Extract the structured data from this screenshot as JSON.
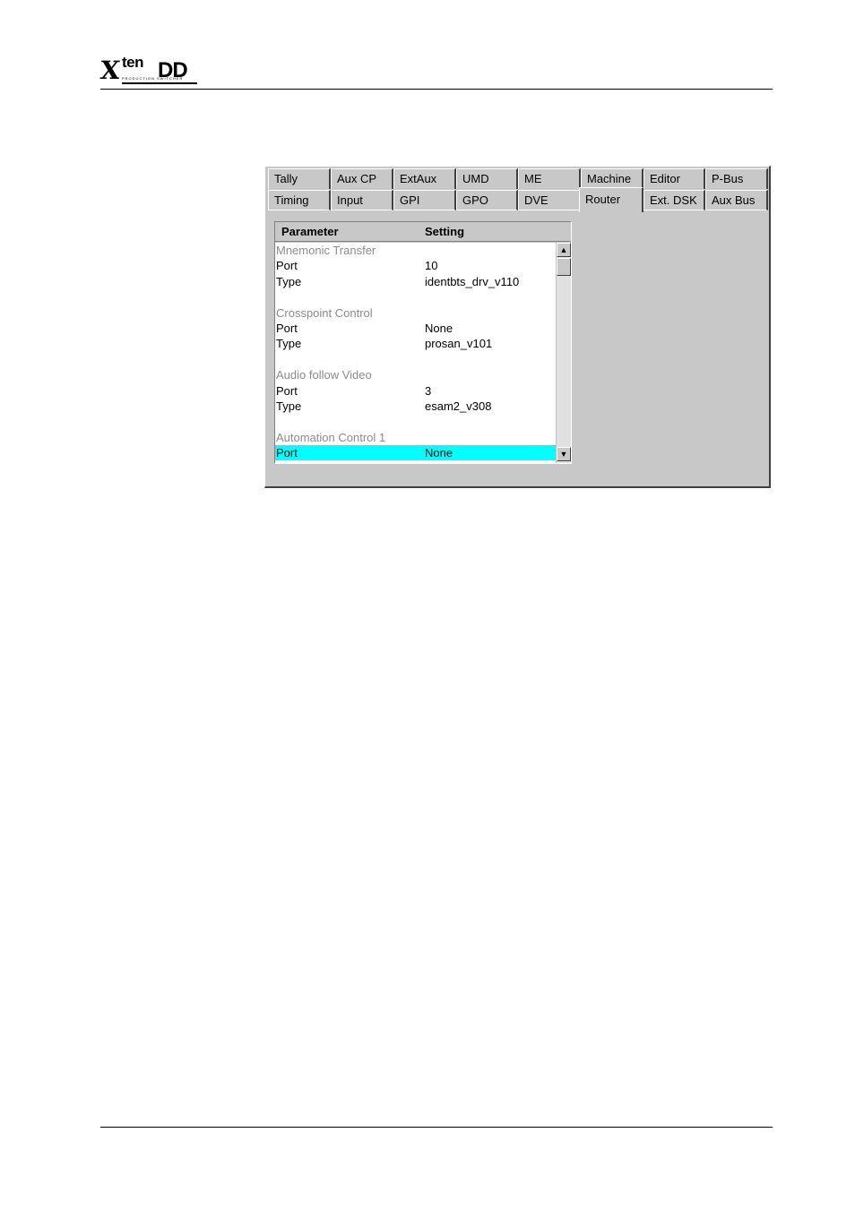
{
  "header": {
    "logo_x": "X",
    "logo_ten": "ten",
    "logo_dd": "DD",
    "logo_subtitle": "PRODUCTION SWITCHER"
  },
  "tabs": {
    "row1": [
      "Tally",
      "Aux CP",
      "ExtAux",
      "UMD",
      "ME",
      "Machine",
      "Editor",
      "P-Bus"
    ],
    "row2": [
      "Timing",
      "Input",
      "GPI",
      "GPO",
      "DVE",
      "Router",
      "Ext. DSK",
      "Aux Bus"
    ],
    "active": "Router"
  },
  "table": {
    "header_parameter": "Parameter",
    "header_setting": "Setting",
    "rows": [
      {
        "parameter": "Mnemonic Transfer",
        "setting": "",
        "kind": "group"
      },
      {
        "parameter": "Port",
        "setting": "10",
        "kind": "item"
      },
      {
        "parameter": "Type",
        "setting": "identbts_drv_v110",
        "kind": "item"
      },
      {
        "parameter": "",
        "setting": "",
        "kind": "blank"
      },
      {
        "parameter": "Crosspoint Control",
        "setting": "",
        "kind": "group"
      },
      {
        "parameter": "Port",
        "setting": "None",
        "kind": "item"
      },
      {
        "parameter": "Type",
        "setting": "prosan_v101",
        "kind": "item"
      },
      {
        "parameter": "",
        "setting": "",
        "kind": "blank"
      },
      {
        "parameter": "Audio follow Video",
        "setting": "",
        "kind": "group"
      },
      {
        "parameter": "Port",
        "setting": "3",
        "kind": "item"
      },
      {
        "parameter": "Type",
        "setting": "esam2_v308",
        "kind": "item"
      },
      {
        "parameter": "",
        "setting": "",
        "kind": "blank"
      },
      {
        "parameter": "Automation Control 1",
        "setting": "",
        "kind": "group"
      },
      {
        "parameter": "Port",
        "setting": "None",
        "kind": "item",
        "selected": true
      }
    ]
  },
  "scrollbar": {
    "up_glyph": "▲",
    "down_glyph": "▼"
  },
  "colors": {
    "window_bg": "#c8c8c8",
    "selection": "#00ffff",
    "group_text": "#8c8c8c"
  }
}
